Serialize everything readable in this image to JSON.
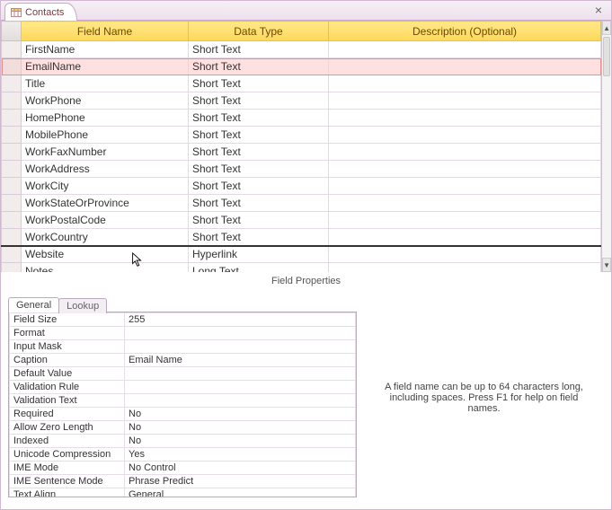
{
  "tab": {
    "title": "Contacts",
    "close_tooltip": "Close"
  },
  "grid": {
    "headers": {
      "field_name": "Field Name",
      "data_type": "Data Type",
      "description": "Description (Optional)"
    },
    "rows": [
      {
        "field": "FirstName",
        "type": "Short Text",
        "desc": "",
        "selected": false
      },
      {
        "field": "EmailName",
        "type": "Short Text",
        "desc": "",
        "selected": true
      },
      {
        "field": "Title",
        "type": "Short Text",
        "desc": "",
        "selected": false
      },
      {
        "field": "WorkPhone",
        "type": "Short Text",
        "desc": "",
        "selected": false
      },
      {
        "field": "HomePhone",
        "type": "Short Text",
        "desc": "",
        "selected": false
      },
      {
        "field": "MobilePhone",
        "type": "Short Text",
        "desc": "",
        "selected": false
      },
      {
        "field": "WorkFaxNumber",
        "type": "Short Text",
        "desc": "",
        "selected": false
      },
      {
        "field": "WorkAddress",
        "type": "Short Text",
        "desc": "",
        "selected": false
      },
      {
        "field": "WorkCity",
        "type": "Short Text",
        "desc": "",
        "selected": false
      },
      {
        "field": "WorkStateOrProvince",
        "type": "Short Text",
        "desc": "",
        "selected": false
      },
      {
        "field": "WorkPostalCode",
        "type": "Short Text",
        "desc": "",
        "selected": false
      },
      {
        "field": "WorkCountry",
        "type": "Short Text",
        "desc": "",
        "selected": false
      },
      {
        "field": "Website",
        "type": "Hyperlink",
        "desc": "",
        "selected": false,
        "heavy_top": true
      },
      {
        "field": "Notes",
        "type": "Long Text",
        "desc": "",
        "selected": false
      }
    ]
  },
  "field_properties": {
    "section_label": "Field Properties",
    "tabs": {
      "general": "General",
      "lookup": "Lookup"
    },
    "rows": [
      {
        "k": "Field Size",
        "v": "255"
      },
      {
        "k": "Format",
        "v": ""
      },
      {
        "k": "Input Mask",
        "v": ""
      },
      {
        "k": "Caption",
        "v": "Email Name"
      },
      {
        "k": "Default Value",
        "v": ""
      },
      {
        "k": "Validation Rule",
        "v": ""
      },
      {
        "k": "Validation Text",
        "v": ""
      },
      {
        "k": "Required",
        "v": "No"
      },
      {
        "k": "Allow Zero Length",
        "v": "No"
      },
      {
        "k": "Indexed",
        "v": "No"
      },
      {
        "k": "Unicode Compression",
        "v": "Yes"
      },
      {
        "k": "IME Mode",
        "v": "No Control"
      },
      {
        "k": "IME Sentence Mode",
        "v": "Phrase Predict"
      },
      {
        "k": "Text Align",
        "v": "General"
      }
    ],
    "help_text": "A field name can be up to 64 characters long, including spaces. Press F1 for help on field names."
  }
}
